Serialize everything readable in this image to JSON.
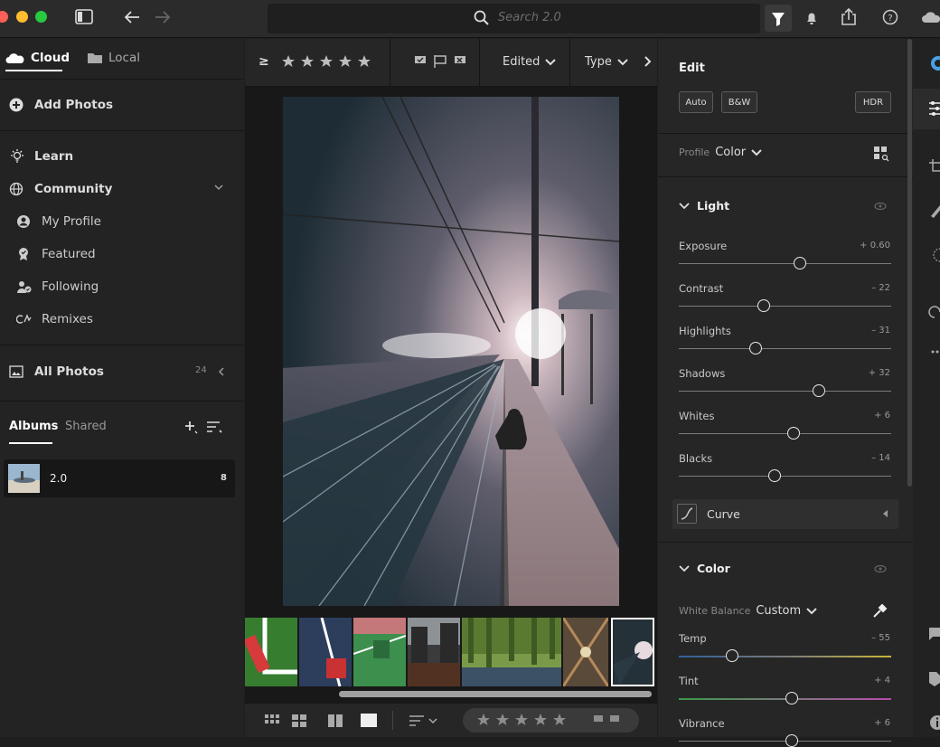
{
  "app": {
    "search_placeholder": "Search 2.0",
    "colors": {
      "accent": "#0d6ff2",
      "selected_thumb_border": "#ffffff"
    }
  },
  "left_panel": {
    "tabs": [
      {
        "label": "Cloud",
        "icon": "cloud-icon"
      },
      {
        "label": "Local",
        "icon": "folder-icon"
      }
    ],
    "add_photos": "Add Photos",
    "learn": "Learn",
    "community": "Community",
    "community_items": [
      "My Profile",
      "Featured",
      "Following",
      "Remixes"
    ],
    "all_photos": "All Photos",
    "all_photos_count": "24",
    "albums_tabs": [
      "Albums",
      "Shared"
    ],
    "albums": [
      {
        "name": "2.0",
        "count": "8"
      }
    ]
  },
  "filter_bar": {
    "ge_symbol": "≥",
    "edited": "Edited",
    "type": "Type"
  },
  "edit": {
    "title": "Edit",
    "buttons": [
      "Auto",
      "B&W",
      "HDR"
    ],
    "profile_label": "Profile",
    "profile_value": "Color",
    "light_section": "Light",
    "sliders": [
      {
        "label": "Exposure",
        "value": "+ 0.60",
        "pos": 0.57
      },
      {
        "label": "Contrast",
        "value": "– 22",
        "pos": 0.4
      },
      {
        "label": "Highlights",
        "value": "– 31",
        "pos": 0.36
      },
      {
        "label": "Shadows",
        "value": "+ 32",
        "pos": 0.66
      },
      {
        "label": "Whites",
        "value": "+ 6",
        "pos": 0.54
      },
      {
        "label": "Blacks",
        "value": "– 14",
        "pos": 0.45
      }
    ],
    "curve": "Curve",
    "color_section": "Color",
    "white_balance_label": "White Balance",
    "white_balance_value": "Custom",
    "color_sliders": [
      {
        "label": "Temp",
        "value": "– 55",
        "pos": 0.25
      },
      {
        "label": "Tint",
        "value": "+ 4",
        "pos": 0.53
      },
      {
        "label": "Vibrance",
        "value": "+ 6",
        "pos": 0.53
      }
    ]
  }
}
